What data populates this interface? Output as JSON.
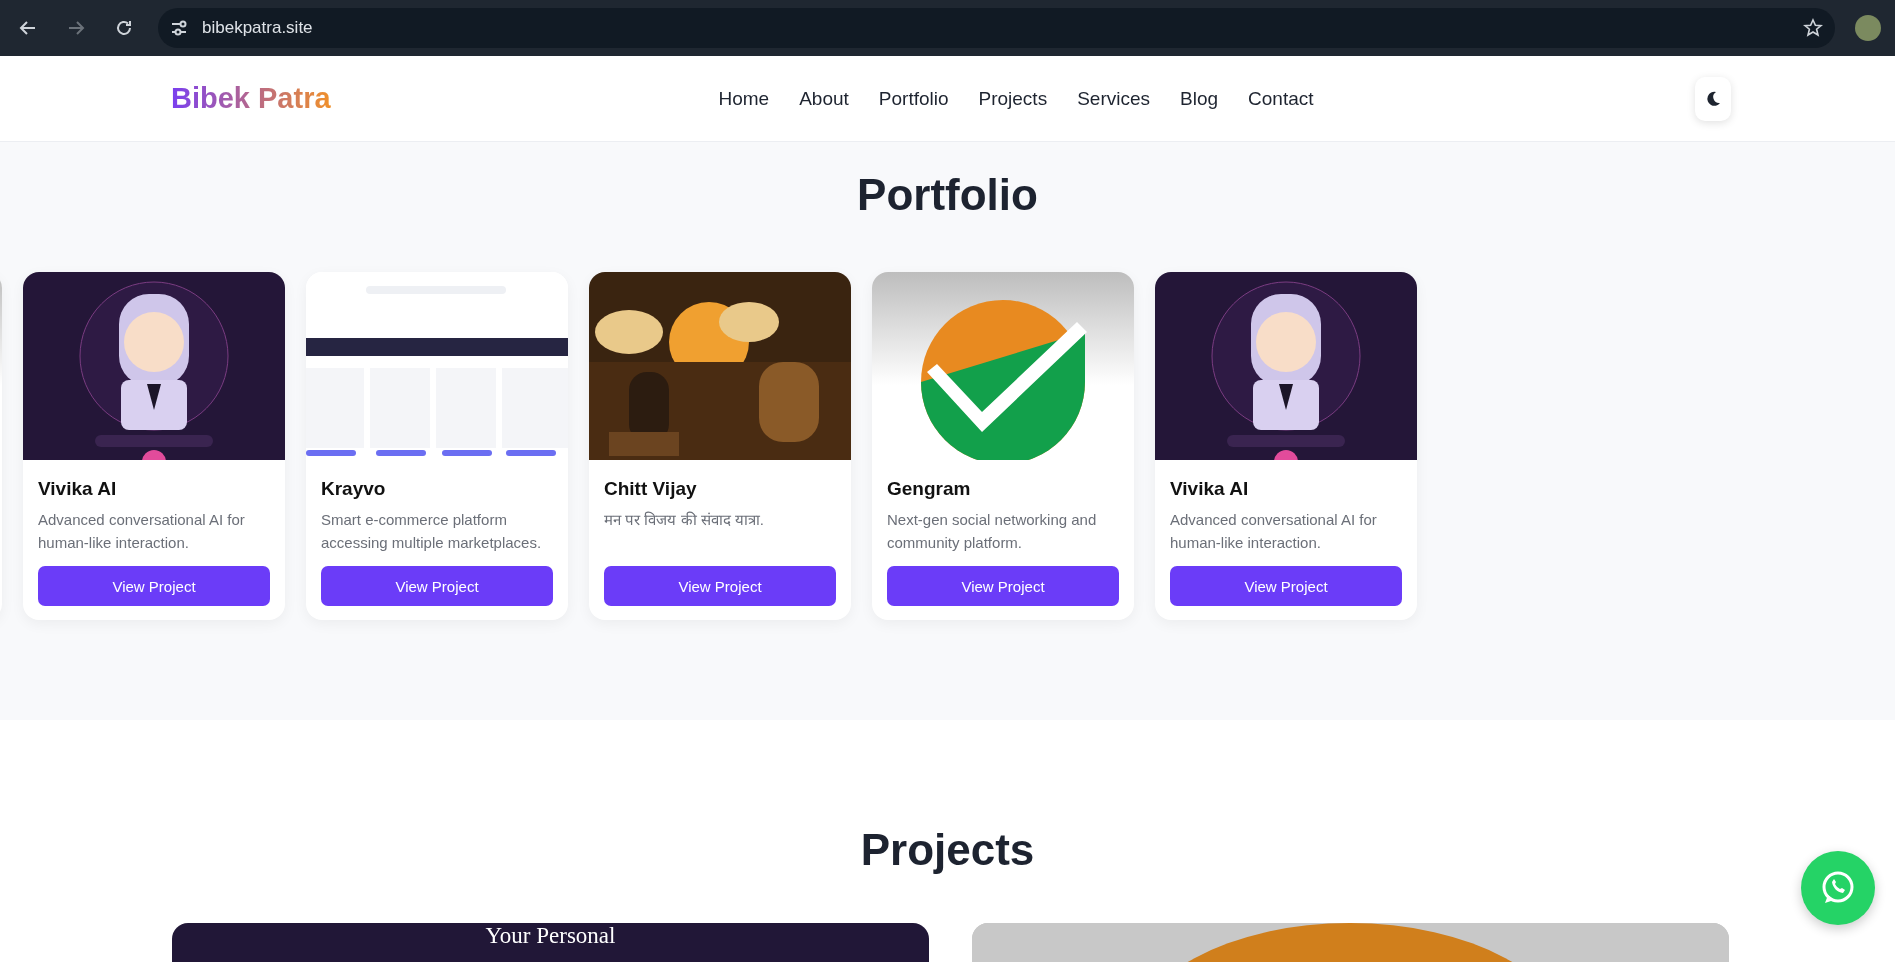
{
  "browser": {
    "url": "bibekpatra.site"
  },
  "nav": {
    "logo": "Bibek Patra",
    "links": [
      {
        "label": "Home"
      },
      {
        "label": "About"
      },
      {
        "label": "Portfolio"
      },
      {
        "label": "Projects"
      },
      {
        "label": "Services"
      },
      {
        "label": "Blog"
      },
      {
        "label": "Contact"
      }
    ]
  },
  "portfolio": {
    "title": "Portfolio",
    "cut_card": {
      "kind": "logo"
    },
    "cards": [
      {
        "title": "Vivika AI",
        "description": "Advanced conversational AI for human-like interaction.",
        "button": "View Project",
        "image": {
          "kind": "character"
        }
      },
      {
        "title": "Krayvo",
        "description": "Smart e-commerce platform accessing multiple marketplaces.",
        "button": "View Project",
        "image": {
          "kind": "screenshot"
        }
      },
      {
        "title": "Chitt Vijay",
        "description": "मन पर विजय की संवाद यात्रा.",
        "button": "View Project",
        "image": {
          "kind": "scene"
        }
      },
      {
        "title": "Gengram",
        "description": "Next-gen social networking and community platform.",
        "button": "View Project",
        "image": {
          "kind": "logo"
        }
      },
      {
        "title": "Vivika AI",
        "description": "Advanced conversational AI for human-like interaction.",
        "button": "View Project",
        "image": {
          "kind": "character"
        }
      }
    ]
  },
  "projects": {
    "title": "Projects",
    "cards": [
      {
        "kind": "dark",
        "heading": "Your Personal"
      },
      {
        "kind": "logo"
      }
    ]
  }
}
